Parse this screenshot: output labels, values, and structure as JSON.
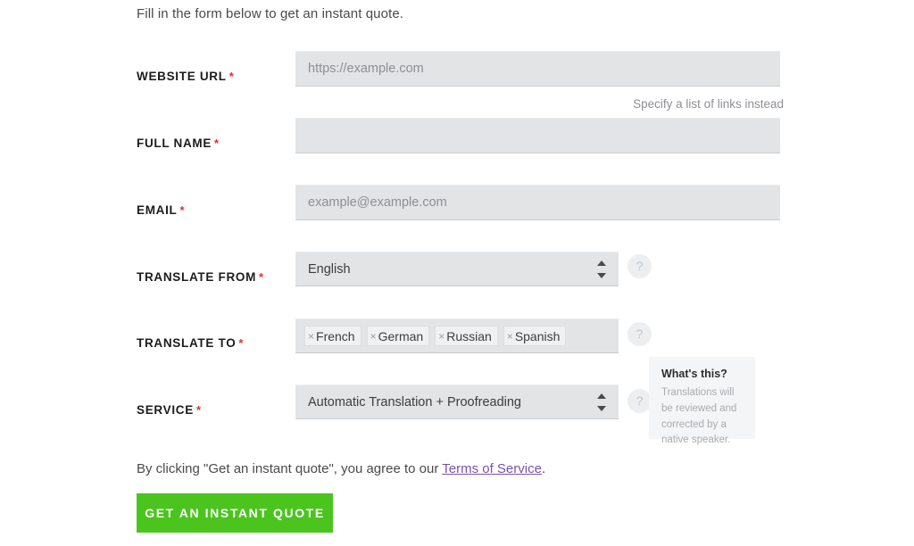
{
  "intro": "Fill in the form below to get an instant quote.",
  "fields": {
    "website": {
      "label": "WEBSITE URL",
      "required_mark": "*",
      "value": "",
      "placeholder": "https://example.com",
      "hint": "Specify a list of links instead"
    },
    "fullname": {
      "label": "FULL NAME",
      "required_mark": "*",
      "value": "",
      "placeholder": ""
    },
    "email": {
      "label": "EMAIL",
      "required_mark": "*",
      "value": "",
      "placeholder": "example@example.com"
    },
    "translate_from": {
      "label": "TRANSLATE FROM",
      "required_mark": "*",
      "selected": "English",
      "help_icon": "question-mark-icon"
    },
    "translate_to": {
      "label": "TRANSLATE TO",
      "required_mark": "*",
      "tags": [
        {
          "remove": "×",
          "name": "French"
        },
        {
          "remove": "×",
          "name": "German"
        },
        {
          "remove": "×",
          "name": "Russian"
        },
        {
          "remove": "×",
          "name": "Spanish"
        }
      ],
      "help_icon": "question-mark-icon"
    },
    "service": {
      "label": "SERVICE",
      "required_mark": "*",
      "selected": "Automatic Translation + Proofreading",
      "help_icon": "question-mark-icon"
    }
  },
  "tooltip": {
    "title": "What's this?",
    "body": "Translations will be reviewed and corrected by a native speaker."
  },
  "terms": {
    "prefix": "By clicking \"Get an instant quote\", you agree to our ",
    "link": "Terms of Service",
    "suffix": "."
  },
  "cta": {
    "label": "GET AN INSTANT QUOTE"
  },
  "help_glyph": "?",
  "colors": {
    "cta_green": "#4cc41e",
    "required_red": "#e03030",
    "link_purple": "#7b52ab",
    "field_bg": "#e2e4e6"
  }
}
